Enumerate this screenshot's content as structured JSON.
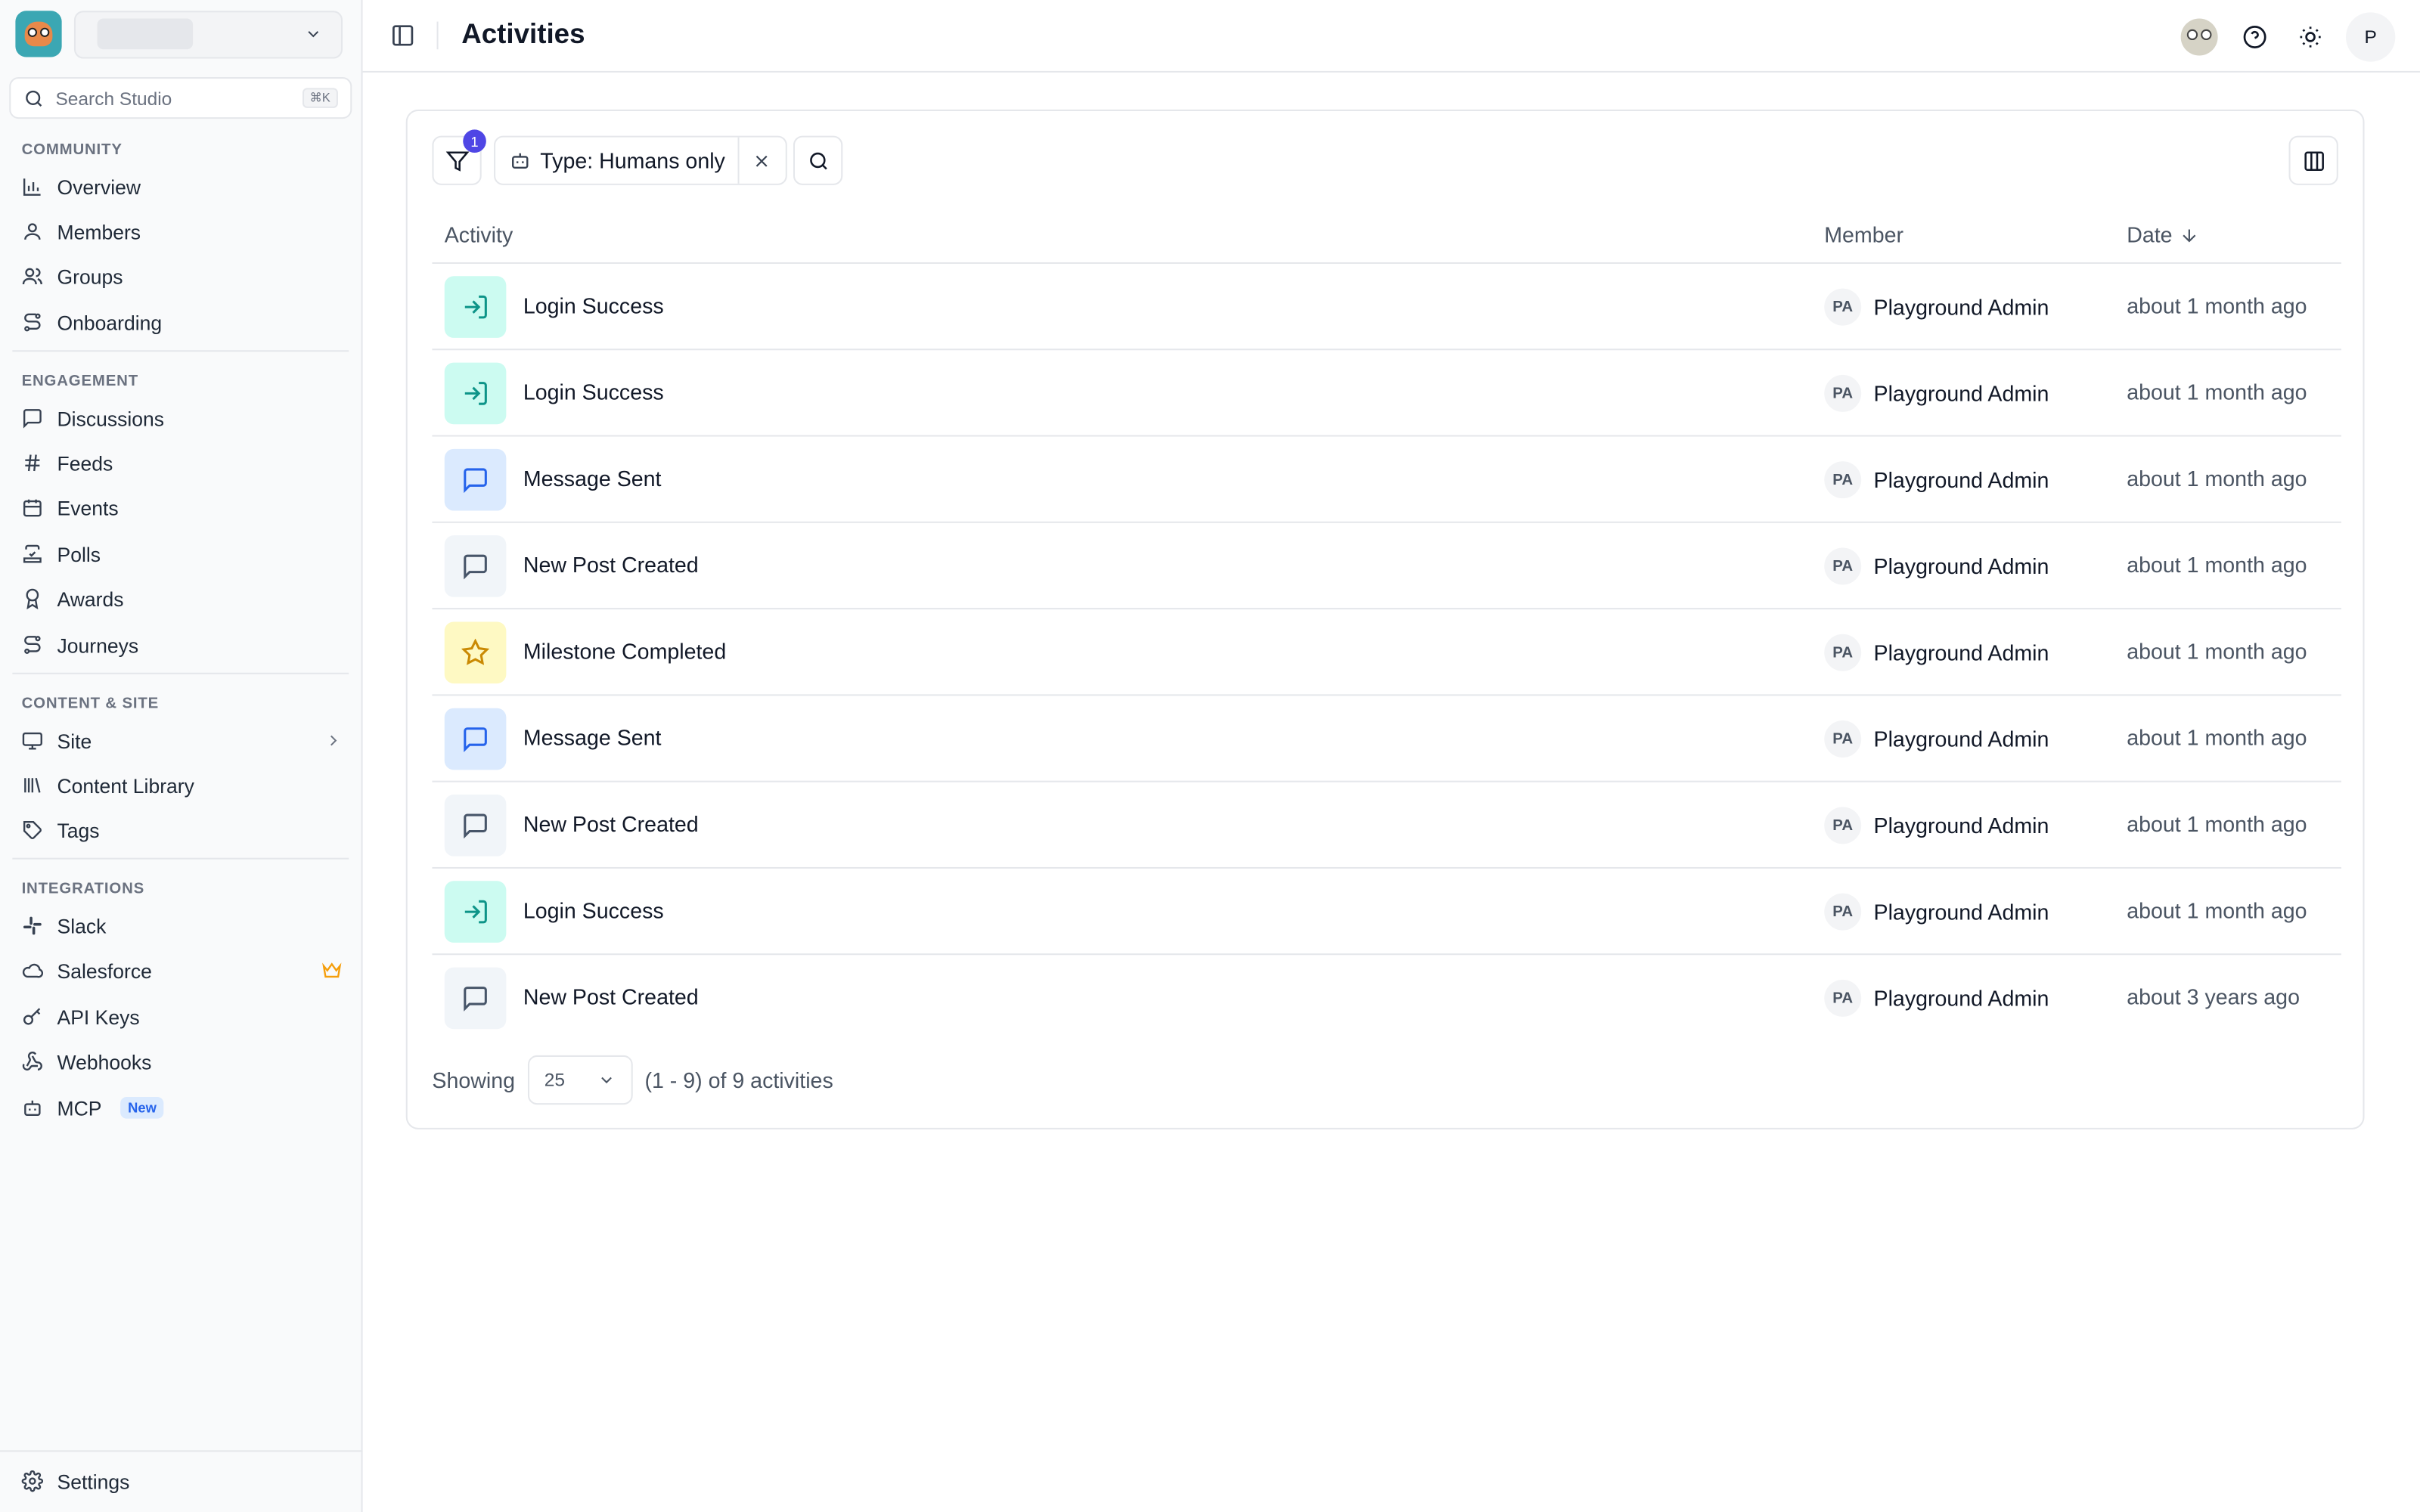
{
  "header": {
    "title": "Activities",
    "user_initial": "P"
  },
  "search": {
    "placeholder": "Search Studio",
    "shortcut": "⌘K"
  },
  "sidebar": {
    "sections": [
      {
        "label": "COMMUNITY",
        "items": [
          "Overview",
          "Members",
          "Groups",
          "Onboarding"
        ]
      },
      {
        "label": "ENGAGEMENT",
        "items": [
          "Discussions",
          "Feeds",
          "Events",
          "Polls",
          "Awards",
          "Journeys"
        ]
      },
      {
        "label": "CONTENT & SITE",
        "items": [
          "Site",
          "Content Library",
          "Tags"
        ]
      },
      {
        "label": "INTEGRATIONS",
        "items": [
          "Slack",
          "Salesforce",
          "API Keys",
          "Webhooks",
          "MCP"
        ]
      }
    ],
    "mcp_badge": "New",
    "settings": "Settings"
  },
  "toolbar": {
    "filter_count": "1",
    "chip_label": "Type: Humans only"
  },
  "table": {
    "columns": {
      "activity": "Activity",
      "member": "Member",
      "date": "Date"
    },
    "rows": [
      {
        "type": "login",
        "activity": "Login Success",
        "member_initials": "PA",
        "member": "Playground Admin",
        "date": "about 1 month ago"
      },
      {
        "type": "login",
        "activity": "Login Success",
        "member_initials": "PA",
        "member": "Playground Admin",
        "date": "about 1 month ago"
      },
      {
        "type": "message",
        "activity": "Message Sent",
        "member_initials": "PA",
        "member": "Playground Admin",
        "date": "about 1 month ago"
      },
      {
        "type": "post",
        "activity": "New Post Created",
        "member_initials": "PA",
        "member": "Playground Admin",
        "date": "about 1 month ago"
      },
      {
        "type": "milestone",
        "activity": "Milestone Completed",
        "member_initials": "PA",
        "member": "Playground Admin",
        "date": "about 1 month ago"
      },
      {
        "type": "message",
        "activity": "Message Sent",
        "member_initials": "PA",
        "member": "Playground Admin",
        "date": "about 1 month ago"
      },
      {
        "type": "post",
        "activity": "New Post Created",
        "member_initials": "PA",
        "member": "Playground Admin",
        "date": "about 1 month ago"
      },
      {
        "type": "login",
        "activity": "Login Success",
        "member_initials": "PA",
        "member": "Playground Admin",
        "date": "about 1 month ago"
      },
      {
        "type": "post",
        "activity": "New Post Created",
        "member_initials": "PA",
        "member": "Playground Admin",
        "date": "about 3 years ago"
      }
    ]
  },
  "footer": {
    "showing_label": "Showing",
    "page_size": "25",
    "range_text": "(1 - 9) of 9 activities"
  },
  "colors": {
    "accent": "#4f46e5",
    "login": "#0d9488",
    "message": "#2563eb",
    "post": "#475569",
    "milestone": "#ca8a04",
    "crown": "#f59e0b"
  }
}
